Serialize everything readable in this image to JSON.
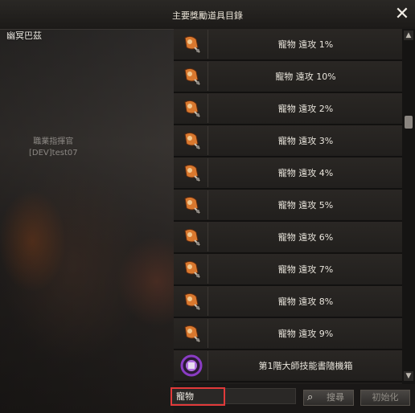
{
  "window": {
    "title": "主要獎勵道具目錄",
    "close_symbol": "✕"
  },
  "scene": {
    "player_name": "幽冥巴茲",
    "npc_title": "職業指揮官",
    "npc_name": "[DEV]test07"
  },
  "items": [
    {
      "label": "寵物 遠攻 1%",
      "icon": "bell-icon"
    },
    {
      "label": "寵物 遠攻 10%",
      "icon": "bell-icon"
    },
    {
      "label": "寵物 遠攻 2%",
      "icon": "bell-icon"
    },
    {
      "label": "寵物 遠攻 3%",
      "icon": "bell-icon"
    },
    {
      "label": "寵物 遠攻 4%",
      "icon": "bell-icon"
    },
    {
      "label": "寵物 遠攻 5%",
      "icon": "bell-icon"
    },
    {
      "label": "寵物 遠攻 6%",
      "icon": "bell-icon"
    },
    {
      "label": "寵物 遠攻 7%",
      "icon": "bell-icon"
    },
    {
      "label": "寵物 遠攻 8%",
      "icon": "bell-icon"
    },
    {
      "label": "寵物 遠攻 9%",
      "icon": "bell-icon"
    },
    {
      "label": "第1階大師技能書隨機箱",
      "icon": "skillbook-box-icon"
    }
  ],
  "search": {
    "value": "寵物",
    "search_label": "搜尋",
    "reset_label": "初始化"
  },
  "colors": {
    "highlight": "#e23a3a",
    "bell_orange": "#d9782e",
    "box_purple": "#8a3cc4"
  }
}
